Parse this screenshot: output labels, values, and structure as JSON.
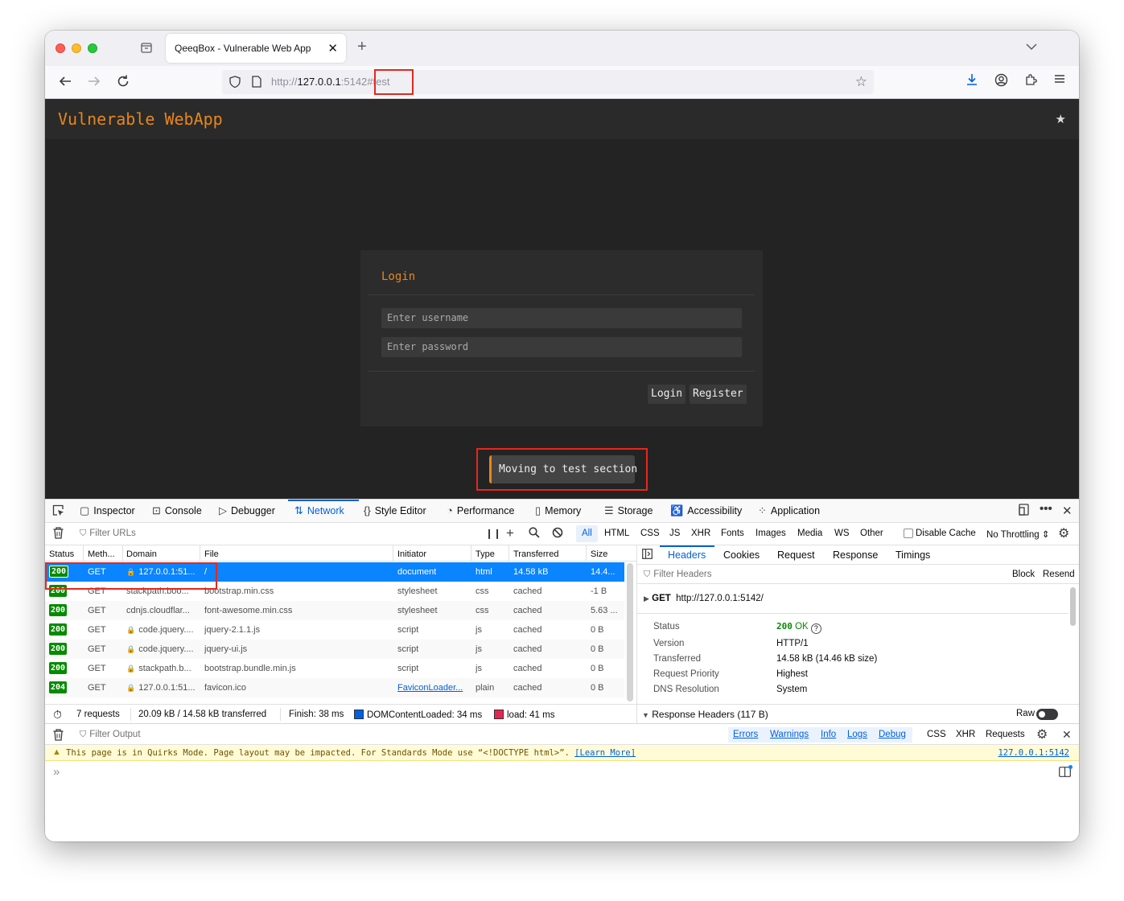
{
  "browser": {
    "tab_title": "QeeqBox - Vulnerable Web App",
    "url_scheme": "http://",
    "url_host": "127.0.0.1",
    "url_port": ":5142",
    "url_hash": "#test"
  },
  "web": {
    "brand": "Vulnerable WebApp",
    "login_title": "Login",
    "username_placeholder": "Enter username",
    "password_placeholder": "Enter password",
    "login_button": "Login",
    "register_button": "Register",
    "toast": "Moving to test section"
  },
  "devtools": {
    "tabs": [
      {
        "label": "Inspector",
        "icon": "inspector-icon"
      },
      {
        "label": "Console",
        "icon": "console-icon"
      },
      {
        "label": "Debugger",
        "icon": "debugger-icon"
      },
      {
        "label": "Network",
        "icon": "network-icon",
        "active": true
      },
      {
        "label": "Style Editor",
        "icon": "style-editor-icon"
      },
      {
        "label": "Performance",
        "icon": "performance-icon"
      },
      {
        "label": "Memory",
        "icon": "memory-icon"
      },
      {
        "label": "Storage",
        "icon": "storage-icon"
      },
      {
        "label": "Accessibility",
        "icon": "accessibility-icon"
      },
      {
        "label": "Application",
        "icon": "application-icon"
      }
    ],
    "network": {
      "filter_placeholder": "Filter URLs",
      "type_filters": [
        "All",
        "HTML",
        "CSS",
        "JS",
        "XHR",
        "Fonts",
        "Images",
        "Media",
        "WS",
        "Other"
      ],
      "disable_cache": "Disable Cache",
      "throttling": "No Throttling",
      "columns": [
        "Status",
        "Meth...",
        "Domain",
        "File",
        "Initiator",
        "Type",
        "Transferred",
        "Size"
      ],
      "rows": [
        {
          "status": "200",
          "method": "GET",
          "domain": "127.0.0.1:51...",
          "secure": true,
          "file": "/",
          "initiator": "document",
          "type": "html",
          "transferred": "14.58 kB",
          "size": "14.4..."
        },
        {
          "status": "200",
          "method": "GET",
          "domain": "stackpath.boo...",
          "secure": false,
          "file": "bootstrap.min.css",
          "initiator": "stylesheet",
          "type": "css",
          "transferred": "cached",
          "size": "-1 B"
        },
        {
          "status": "200",
          "method": "GET",
          "domain": "cdnjs.cloudflar...",
          "secure": false,
          "file": "font-awesome.min.css",
          "initiator": "stylesheet",
          "type": "css",
          "transferred": "cached",
          "size": "5.63 ..."
        },
        {
          "status": "200",
          "method": "GET",
          "domain": "code.jquery....",
          "secure": true,
          "file": "jquery-2.1.1.js",
          "initiator": "script",
          "type": "js",
          "transferred": "cached",
          "size": "0 B"
        },
        {
          "status": "200",
          "method": "GET",
          "domain": "code.jquery....",
          "secure": true,
          "file": "jquery-ui.js",
          "initiator": "script",
          "type": "js",
          "transferred": "cached",
          "size": "0 B"
        },
        {
          "status": "200",
          "method": "GET",
          "domain": "stackpath.b...",
          "secure": true,
          "file": "bootstrap.bundle.min.js",
          "initiator": "script",
          "type": "js",
          "transferred": "cached",
          "size": "0 B"
        },
        {
          "status": "204",
          "method": "GET",
          "domain": "127.0.0.1:51...",
          "secure": true,
          "file": "favicon.ico",
          "initiator": "FaviconLoader...",
          "type": "plain",
          "transferred": "cached",
          "size": "0 B"
        }
      ],
      "summary": {
        "requests": "7 requests",
        "transferred": "20.09 kB / 14.58 kB transferred",
        "finish": "Finish: 38 ms",
        "dcl": "DOMContentLoaded: 34 ms",
        "load": "load: 41 ms"
      }
    },
    "sidebar": {
      "tabs": [
        "Headers",
        "Cookies",
        "Request",
        "Response",
        "Timings"
      ],
      "filter_placeholder": "Filter Headers",
      "block": "Block",
      "resend": "Resend",
      "request_method": "GET",
      "request_url": "http://127.0.0.1:5142/",
      "fields": {
        "status_label": "Status",
        "status_code": "200",
        "status_text": "OK",
        "version_label": "Version",
        "version": "HTTP/1",
        "transferred_label": "Transferred",
        "transferred": "14.58 kB (14.46 kB size)",
        "priority_label": "Request Priority",
        "priority": "Highest",
        "dns_label": "DNS Resolution",
        "dns": "System"
      },
      "response_headers": "Response Headers (117 B)",
      "raw": "Raw"
    },
    "console": {
      "filter_placeholder": "Filter Output",
      "levels": [
        "Errors",
        "Warnings",
        "Info",
        "Logs",
        "Debug"
      ],
      "categories": [
        "CSS",
        "XHR",
        "Requests"
      ],
      "warning_text": "This page is in Quirks Mode. Page layout may be impacted. For Standards Mode use “<!DOCTYPE html>”.",
      "warning_link": "[Learn More]",
      "warning_source": "127.0.0.1:5142"
    }
  }
}
